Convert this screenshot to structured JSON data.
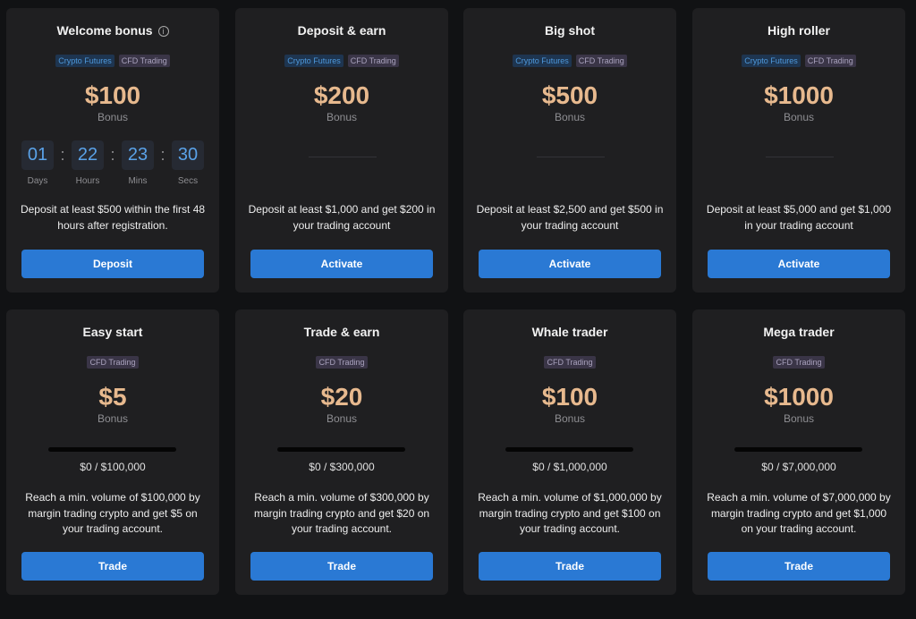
{
  "bonus_label": "Bonus",
  "deposit_cards": [
    {
      "title": "Welcome bonus",
      "tags": [
        "Crypto Futures",
        "CFD Trading"
      ],
      "amount": "$100",
      "description": "Deposit at least $500 within the first 48 hours after registration.",
      "button": "Deposit",
      "has_info_icon": true
    },
    {
      "title": "Deposit & earn",
      "tags": [
        "Crypto Futures",
        "CFD Trading"
      ],
      "amount": "$200",
      "description": "Deposit at least $1,000 and get $200 in your trading account",
      "button": "Activate"
    },
    {
      "title": "Big shot",
      "tags": [
        "Crypto Futures",
        "CFD Trading"
      ],
      "amount": "$500",
      "description": "Deposit at least $2,500 and get $500 in your trading account",
      "button": "Activate"
    },
    {
      "title": "High roller",
      "tags": [
        "Crypto Futures",
        "CFD Trading"
      ],
      "amount": "$1000",
      "description": "Deposit at least $5,000 and get $1,000 in your trading account",
      "button": "Activate"
    }
  ],
  "countdown": {
    "days": "01",
    "hours": "22",
    "mins": "23",
    "secs": "30",
    "days_label": "Days",
    "hours_label": "Hours",
    "mins_label": "Mins",
    "secs_label": "Secs"
  },
  "trade_cards": [
    {
      "title": "Easy start",
      "tags": [
        "CFD Trading"
      ],
      "amount": "$5",
      "progress_text": "$0 / $100,000",
      "progress_fraction": 0,
      "description": "Reach a min. volume of $100,000 by margin trading crypto and get $5 on your trading account.",
      "button": "Trade"
    },
    {
      "title": "Trade & earn",
      "tags": [
        "CFD Trading"
      ],
      "amount": "$20",
      "progress_text": "$0 / $300,000",
      "progress_fraction": 0,
      "description": "Reach a min. volume of $300,000 by margin trading crypto and get $20 on your trading account.",
      "button": "Trade"
    },
    {
      "title": "Whale trader",
      "tags": [
        "CFD Trading"
      ],
      "amount": "$100",
      "progress_text": "$0 / $1,000,000",
      "progress_fraction": 0,
      "description": "Reach a min. volume of $1,000,000 by margin trading crypto and get $100 on your trading account.",
      "button": "Trade"
    },
    {
      "title": "Mega trader",
      "tags": [
        "CFD Trading"
      ],
      "amount": "$1000",
      "progress_text": "$0 / $7,000,000",
      "progress_fraction": 0,
      "description": "Reach a min. volume of $7,000,000 by margin trading crypto and get $1,000 on your trading account.",
      "button": "Trade"
    }
  ],
  "colors": {
    "accent_button": "#2a79d4",
    "amount_gold": "#e7b98e",
    "crypto_tag": "#4e98db",
    "card_bg": "#1f1f21"
  }
}
